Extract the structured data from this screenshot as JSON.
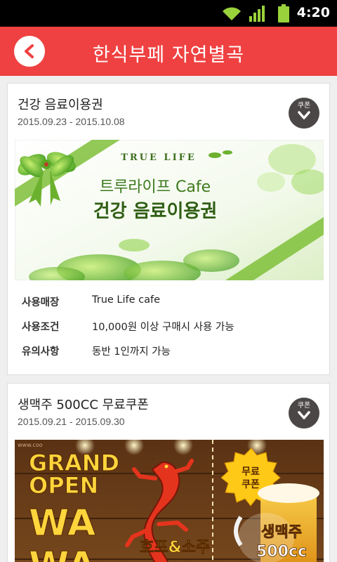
{
  "status_bar": {
    "time": "4:20"
  },
  "header": {
    "title": "한식부페 자연별곡"
  },
  "coupon_label": "쿠폰",
  "cards": [
    {
      "title": "건강 음료이용권",
      "date": "2015.09.23 - 2015.10.08",
      "banner": {
        "brand": "TRUE LIFE",
        "line1": "트루라이프 Cafe",
        "line2": "건강 음료이용권"
      },
      "details": [
        {
          "key": "사용매장",
          "value": "True Life cafe"
        },
        {
          "key": "사용조건",
          "value": "10,000원 이상 구매시 사용 가능"
        },
        {
          "key": "유의사항",
          "value": "동반 1인까지 가능"
        }
      ]
    },
    {
      "title": "생맥주 500CC 무료쿠폰",
      "date": "2015.09.21 - 2015.09.30",
      "banner": {
        "watermark": "www.coo",
        "grand": "GRAND",
        "open": "OPEN",
        "wa1": "WA",
        "wa2": "WA",
        "hof": "호프&소주",
        "free1": "무료",
        "free2": "쿠폰",
        "beer1": "생맥주",
        "beer2": "500cc"
      }
    }
  ]
}
